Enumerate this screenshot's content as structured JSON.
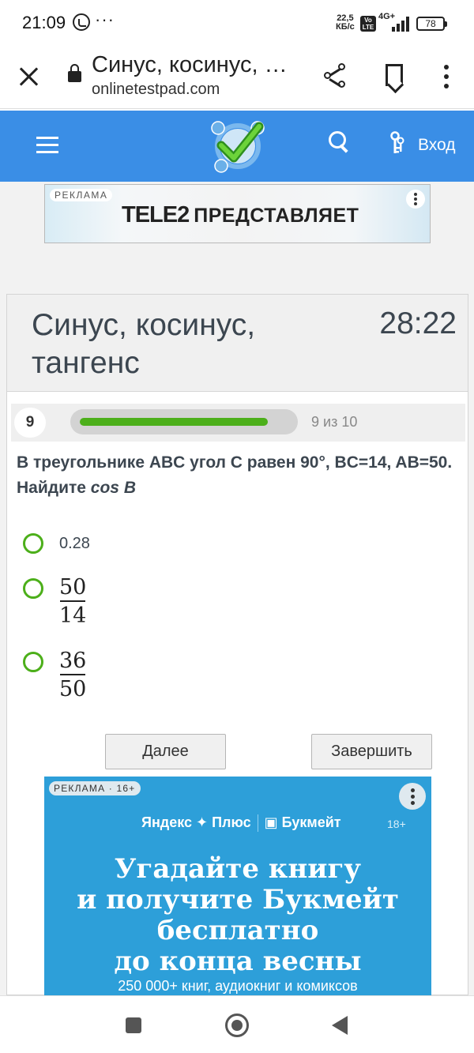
{
  "status_bar": {
    "time": "21:09",
    "more": "···",
    "speed_value": "22,5",
    "speed_unit": "КБ/с",
    "volte": "Vo LTE",
    "network": "4G+",
    "battery": "78"
  },
  "browser": {
    "page_title": "Синус, косинус, …",
    "url": "onlinetestpad.com"
  },
  "site_header": {
    "login_label": "Вход"
  },
  "ad_top": {
    "badge": "РЕКЛАМА",
    "brand": "TELE2",
    "text": "ПРЕДСТАВЛЯЕТ"
  },
  "test": {
    "title": "Синус, косинус, тангенс",
    "timer": "28:22",
    "question_number": "9",
    "progress_text": "9 из 10",
    "progress_fraction": 0.9,
    "question_text": "В треугольнике ABC угол C равен 90°, BC=14, AB=50. Найдите ",
    "question_formula": "cos B",
    "options": [
      {
        "text": "0.28"
      },
      {
        "numerator": "50",
        "denominator": "14"
      },
      {
        "numerator": "36",
        "denominator": "50"
      }
    ],
    "next_label": "Далее",
    "finish_label": "Завершить"
  },
  "ad_bottom": {
    "badge": "РЕКЛАМА · 16+",
    "brand_1": "Яндекс ✦ Плюс",
    "brand_2": "Букмейт",
    "age": "18+",
    "headline_lines": [
      "Угадайте книгу",
      "и получите Букмейт",
      "бесплатно",
      "до конца весны"
    ],
    "subline": "250 000+ книг, аудиокниг и комиксов"
  },
  "colors": {
    "header_blue": "#3a8ee6",
    "accent_green": "#4caf1a",
    "ad_blue": "#2d9fd9"
  }
}
